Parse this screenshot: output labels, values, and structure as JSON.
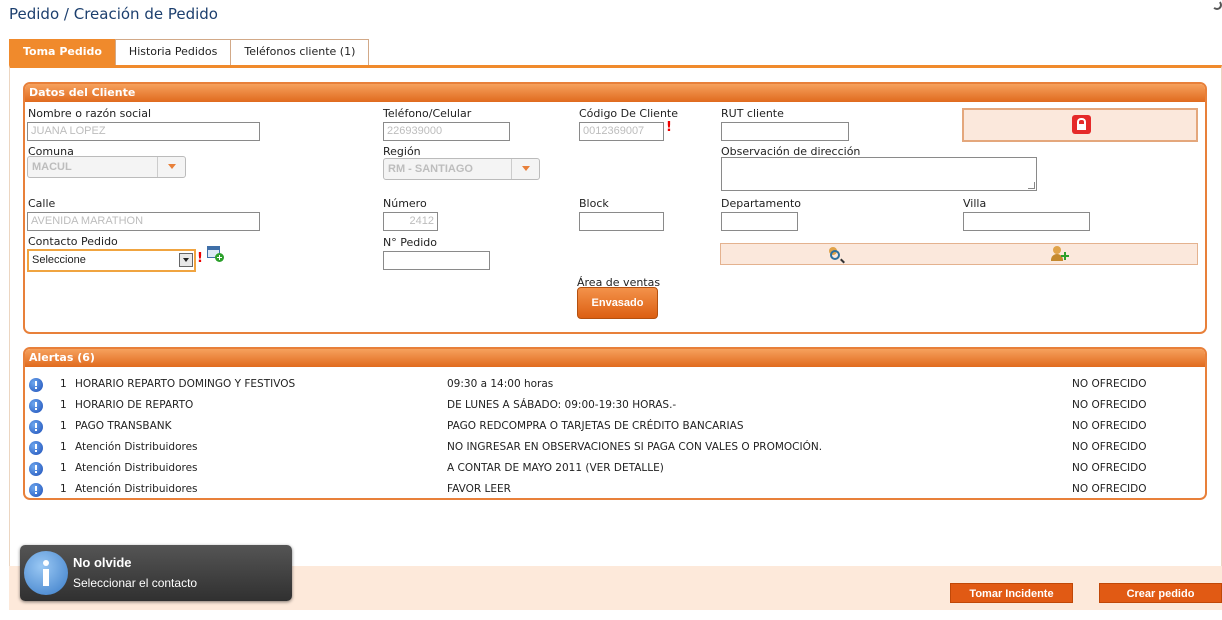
{
  "page": {
    "title": "Pedido / Creación de Pedido"
  },
  "tabs": [
    {
      "label": "Toma Pedido",
      "active": true
    },
    {
      "label": "Historia Pedidos",
      "active": false
    },
    {
      "label": "Teléfonos cliente (1)",
      "active": false
    }
  ],
  "cliente": {
    "header": "Datos del Cliente",
    "nombre": {
      "label": "Nombre o razón social",
      "value": "JUANA LOPEZ"
    },
    "telefono": {
      "label": "Teléfono/Celular",
      "value": "226939000"
    },
    "codigo": {
      "label": "Código De Cliente",
      "value": "0012369007",
      "required": "!"
    },
    "rut": {
      "label": "RUT cliente",
      "value": ""
    },
    "comuna": {
      "label": "Comuna",
      "value": "MACUL"
    },
    "region": {
      "label": "Región",
      "value": "RM - SANTIAGO"
    },
    "observacion": {
      "label": "Observación de dirección",
      "value": ""
    },
    "calle": {
      "label": "Calle",
      "value": "AVENIDA MARATHON"
    },
    "numero": {
      "label": "Número",
      "value": "2412"
    },
    "block": {
      "label": "Block",
      "value": ""
    },
    "departamento": {
      "label": "Departamento",
      "value": ""
    },
    "villa": {
      "label": "Villa",
      "value": ""
    },
    "contacto": {
      "label": "Contacto Pedido",
      "value": "Seleccione",
      "required": "!"
    },
    "pedido": {
      "label": "N° Pedido",
      "value": ""
    },
    "area_ventas": {
      "label": "Área de ventas",
      "button": "Envasado"
    }
  },
  "alertas": {
    "header": "Alertas (6)",
    "rows": [
      {
        "count": "1",
        "name": "HORARIO REPARTO DOMINGO Y FESTIVOS",
        "detail": "09:30 a 14:00 horas",
        "status": "NO OFRECIDO"
      },
      {
        "count": "1",
        "name": "HORARIO DE REPARTO",
        "detail": "DE LUNES A SÁBADO: 09:00-19:30 HORAS.-",
        "status": "NO OFRECIDO"
      },
      {
        "count": "1",
        "name": "PAGO TRANSBANK",
        "detail": "PAGO REDCOMPRA O TARJETAS DE CRÉDITO BANCARIAS",
        "status": "NO OFRECIDO"
      },
      {
        "count": "1",
        "name": "Atención Distribuidores",
        "detail": "NO INGRESAR EN OBSERVACIONES SI PAGA CON VALES O PROMOCIÓN.",
        "status": "NO OFRECIDO"
      },
      {
        "count": "1",
        "name": "Atención Distribuidores",
        "detail": "A CONTAR DE MAYO 2011 (VER DETALLE)",
        "status": "NO OFRECIDO"
      },
      {
        "count": "1",
        "name": "Atención Distribuidores",
        "detail": "FAVOR LEER",
        "status": "NO OFRECIDO"
      }
    ]
  },
  "toast": {
    "title": "No olvide",
    "message": "Seleccionar el contacto"
  },
  "footer": {
    "tomar_incidente": "Tomar Incidente",
    "crear_pedido": "Crear pedido"
  },
  "colors": {
    "accent": "#f08a2c",
    "panel_border": "#e8803a",
    "button": "#e15a14",
    "required": "#e00000"
  }
}
